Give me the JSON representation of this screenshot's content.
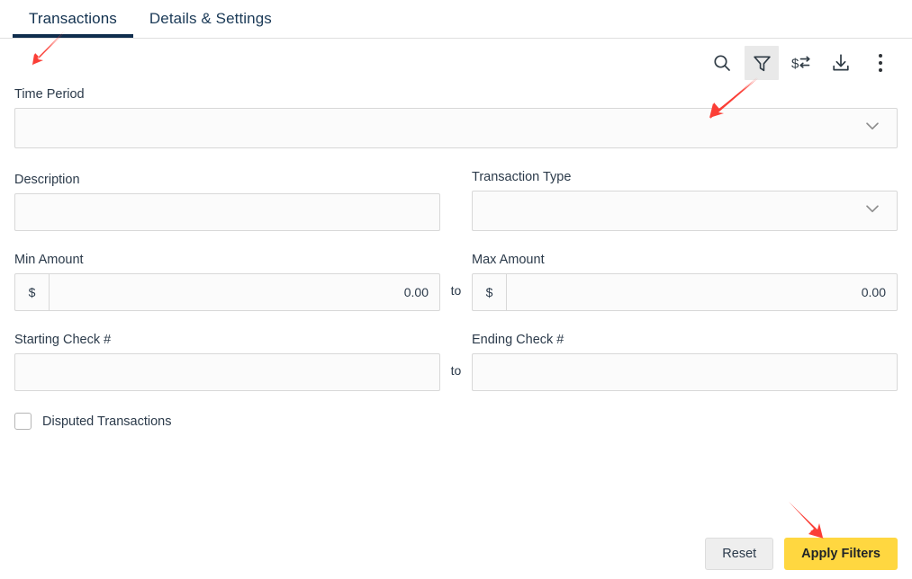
{
  "tabs": [
    {
      "label": "Transactions",
      "active": true
    },
    {
      "label": "Details & Settings",
      "active": false
    }
  ],
  "toolbar": {
    "icons": [
      {
        "name": "search-icon",
        "label": "Search",
        "active": false
      },
      {
        "name": "filter-icon",
        "label": "Filter",
        "active": true
      },
      {
        "name": "transfer-icon",
        "label": "Transfer",
        "active": false
      },
      {
        "name": "download-icon",
        "label": "Download",
        "active": false
      },
      {
        "name": "more-options-icon",
        "label": "More options",
        "active": false
      }
    ]
  },
  "filters": {
    "time_period": {
      "label": "Time Period",
      "value": "",
      "placeholder": ""
    },
    "description": {
      "label": "Description",
      "value": "",
      "placeholder": ""
    },
    "transaction_type": {
      "label": "Transaction Type",
      "value": "",
      "placeholder": ""
    },
    "min_amount": {
      "label": "Min Amount",
      "symbol": "$",
      "value": "0.00"
    },
    "max_amount": {
      "label": "Max Amount",
      "symbol": "$",
      "value": "0.00"
    },
    "starting_check": {
      "label": "Starting Check #",
      "value": "",
      "placeholder": ""
    },
    "ending_check": {
      "label": "Ending Check #",
      "value": "",
      "placeholder": ""
    },
    "range_separator": "to",
    "disputed": {
      "label": "Disputed Transactions",
      "checked": false
    }
  },
  "actions": {
    "reset_label": "Reset",
    "apply_label": "Apply Filters"
  },
  "colors": {
    "tab_active_underline": "#0f2d4d",
    "tab_text": "#12314f",
    "apply_button_bg": "#ffd740",
    "reset_button_bg": "#eeeeee",
    "annotation_arrow": "#fb3e36",
    "field_border": "#d8d8d8",
    "field_bg": "#fbfbfb",
    "toolbar_active_bg": "#e9e9e9"
  },
  "annotations": [
    {
      "name": "arrow-to-transactions-tab",
      "points_to": "Transactions tab"
    },
    {
      "name": "arrow-to-filter-icon",
      "points_to": "Filter toolbar icon"
    },
    {
      "name": "arrow-to-apply-filters",
      "points_to": "Apply Filters button"
    }
  ]
}
